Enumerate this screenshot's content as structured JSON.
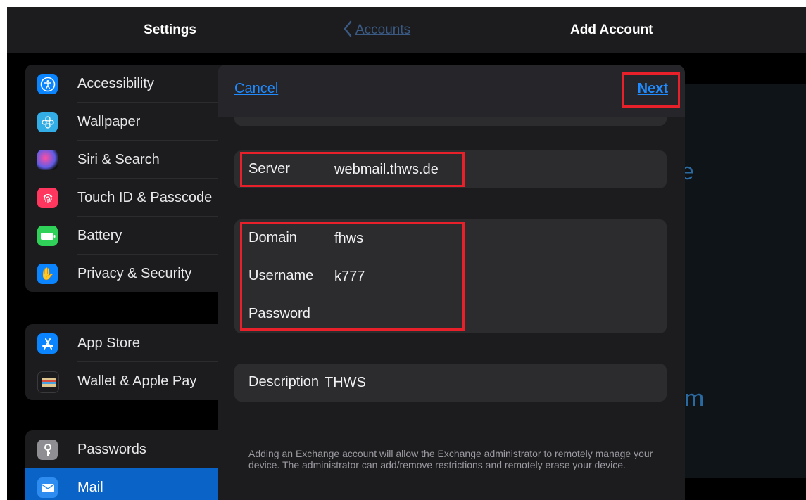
{
  "settings": {
    "title": "Settings",
    "group1": [
      {
        "label": "Accessibility",
        "icon": "accessibility-icon",
        "color": "#0a84ff"
      },
      {
        "label": "Wallpaper",
        "icon": "wallpaper-icon",
        "color": "#32ade6"
      },
      {
        "label": "Siri & Search",
        "icon": "siri-icon",
        "color": "#5e5ce6"
      },
      {
        "label": "Touch ID & Passcode",
        "icon": "fingerprint-icon",
        "color": "#ff375f"
      },
      {
        "label": "Battery",
        "icon": "battery-icon",
        "color": "#30d158"
      },
      {
        "label": "Privacy & Security",
        "icon": "hand-icon",
        "color": "#0a84ff"
      }
    ],
    "group2": [
      {
        "label": "App Store",
        "icon": "app-store-icon",
        "color": "#0a84ff"
      },
      {
        "label": "Wallet & Apple Pay",
        "icon": "wallet-icon",
        "color": "#3a3a3c"
      }
    ],
    "group3": [
      {
        "label": "Passwords",
        "icon": "key-icon",
        "color": "#8e8e93"
      },
      {
        "label": "Mail",
        "icon": "mail-icon",
        "color": "#0a84ff"
      }
    ]
  },
  "header": {
    "back_label": "Accounts",
    "title": "Add Account"
  },
  "modal": {
    "cancel_label": "Cancel",
    "next_label": "Next",
    "server": {
      "label": "Server",
      "value": "webmail.thws.de"
    },
    "domain": {
      "label": "Domain",
      "value": "fhws"
    },
    "username": {
      "label": "Username",
      "value": "k777"
    },
    "password": {
      "label": "Password",
      "value": ""
    },
    "description": {
      "label": "Description",
      "value": "THWS"
    },
    "note": "Adding an Exchange account will allow the Exchange administrator to remotely manage your device. The administrator can add/remove restrictions and remotely erase your device."
  },
  "background_fragments": {
    "frag1": "ge",
    "frag2": "m"
  },
  "colors": {
    "accent": "#1f8bff",
    "highlight": "#e8202a"
  }
}
